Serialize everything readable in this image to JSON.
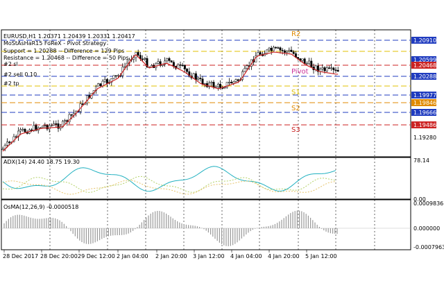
{
  "main_panel": {
    "header_line": "EURUSD,H1  1.20371 1.20439 1.20331 1.20417",
    "indicator_name": "MoStAsHaR15 FoReX - Pivot Strategy",
    "support_info": "Support = 1.20288 -- Difference = 129 Pips",
    "resistance_info": "Resistance = 1.20468 -- Difference = 50 Pips",
    "trade_labels": [
      "#2 sl",
      "#2 sell 0.10",
      "#2 tp"
    ],
    "level_labels": [
      "R2",
      "Pivot",
      "S1",
      "S2",
      "S3"
    ],
    "price_tags": [
      {
        "text": "1.20910",
        "color": "#1f3bbf"
      },
      {
        "text": "1.20599",
        "color": "#1f3bbf"
      },
      {
        "text": "1.20468",
        "color": "#cc2222"
      },
      {
        "text": "1.20288",
        "color": "#1f3bbf"
      },
      {
        "text": "1.19977",
        "color": "#1f3bbf"
      },
      {
        "text": "1.19846",
        "color": "#e08a00"
      },
      {
        "text": "1.19666",
        "color": "#1f3bbf"
      },
      {
        "text": "1.19486",
        "color": "#cc2222"
      }
    ],
    "axis_price_label": "1.19280"
  },
  "adx_panel": {
    "title": "ADX(14) 24.40 18.75 19.30",
    "scale_top": "78.14",
    "scale_bottom": "0.00"
  },
  "osma_panel": {
    "title": "OsMA(12,26,9) -0.0000518",
    "scale_top": "0.0009836",
    "scale_mid": "0.000000",
    "scale_bottom": "-0.0007963"
  },
  "time_axis": [
    "28 Dec 2017",
    "28 Dec 20:00",
    "29 Dec 12:00",
    "2 Jan 04:00",
    "2 Jan 20:00",
    "3 Jan 12:00",
    "4 Jan 04:00",
    "4 Jan 20:00",
    "5 Jan 12:00"
  ],
  "colors": {
    "candle_up": "#ffffff",
    "candle_down": "#000000",
    "ma_line": "#cc2222",
    "resistance_line": "#cc2222",
    "support_line": "#1f3bbf",
    "s1_line": "#e0c000",
    "s2_line": "#e08a00",
    "pivot_label": "#cc3399",
    "adx_line": "#20b0c0",
    "di_plus": "#b5d26a",
    "di_minus": "#e6c36a"
  }
}
